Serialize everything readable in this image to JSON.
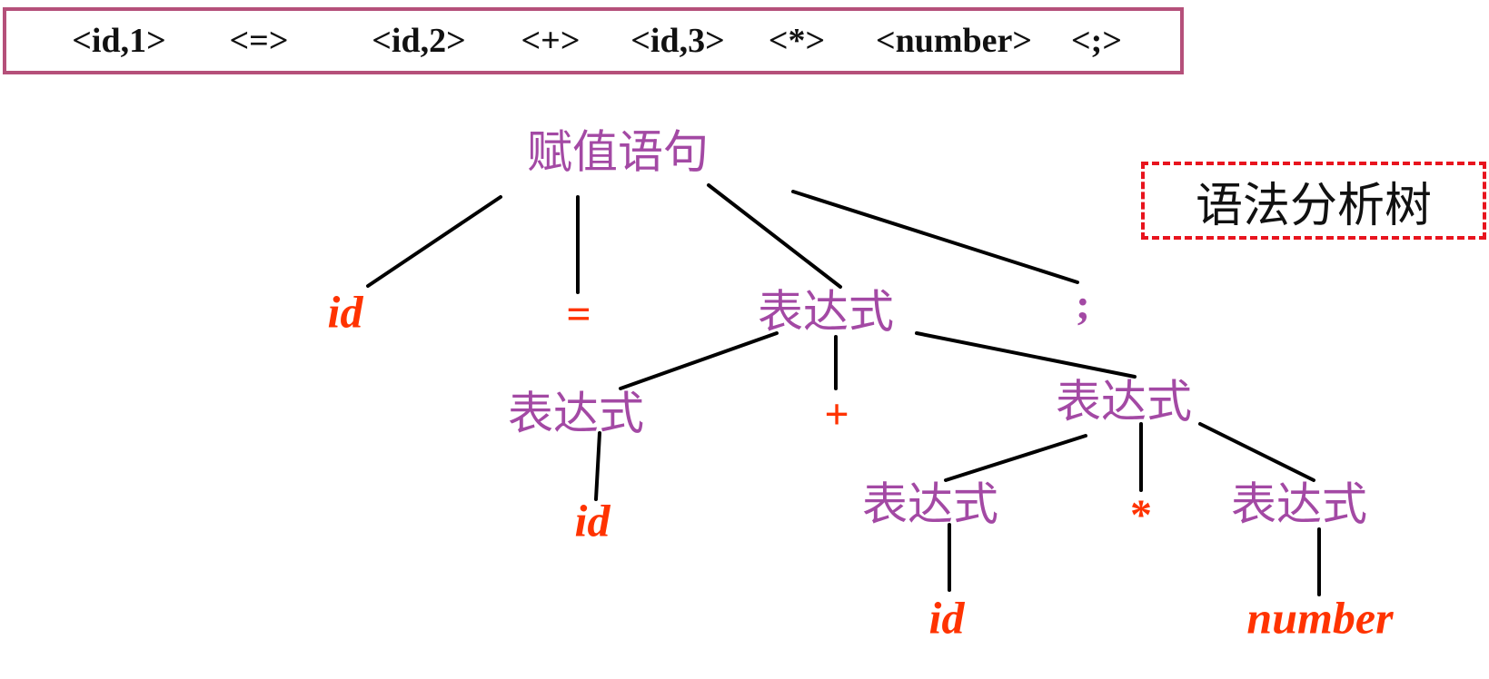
{
  "tokens": [
    "<id,1>",
    "<=>",
    "<id,2>",
    "<+>",
    "<id,3>",
    "<*>",
    "<number>",
    "<;>"
  ],
  "legend": {
    "label": "语法分析树"
  },
  "tree": {
    "root": "赋值语句",
    "children_of_root": [
      "id",
      "=",
      "表达式",
      ";"
    ],
    "expr_level1": [
      "表达式",
      "+",
      "表达式"
    ],
    "expr_left_child": "id",
    "expr_right_children": [
      "表达式",
      "*",
      "表达式"
    ],
    "expr_right_left_child": "id",
    "expr_right_right_child": "number"
  },
  "colors": {
    "nonterminal": "#a349a4",
    "terminal": "#ff3300",
    "token_border": "#b5507a",
    "legend_border": "#e8141e"
  }
}
